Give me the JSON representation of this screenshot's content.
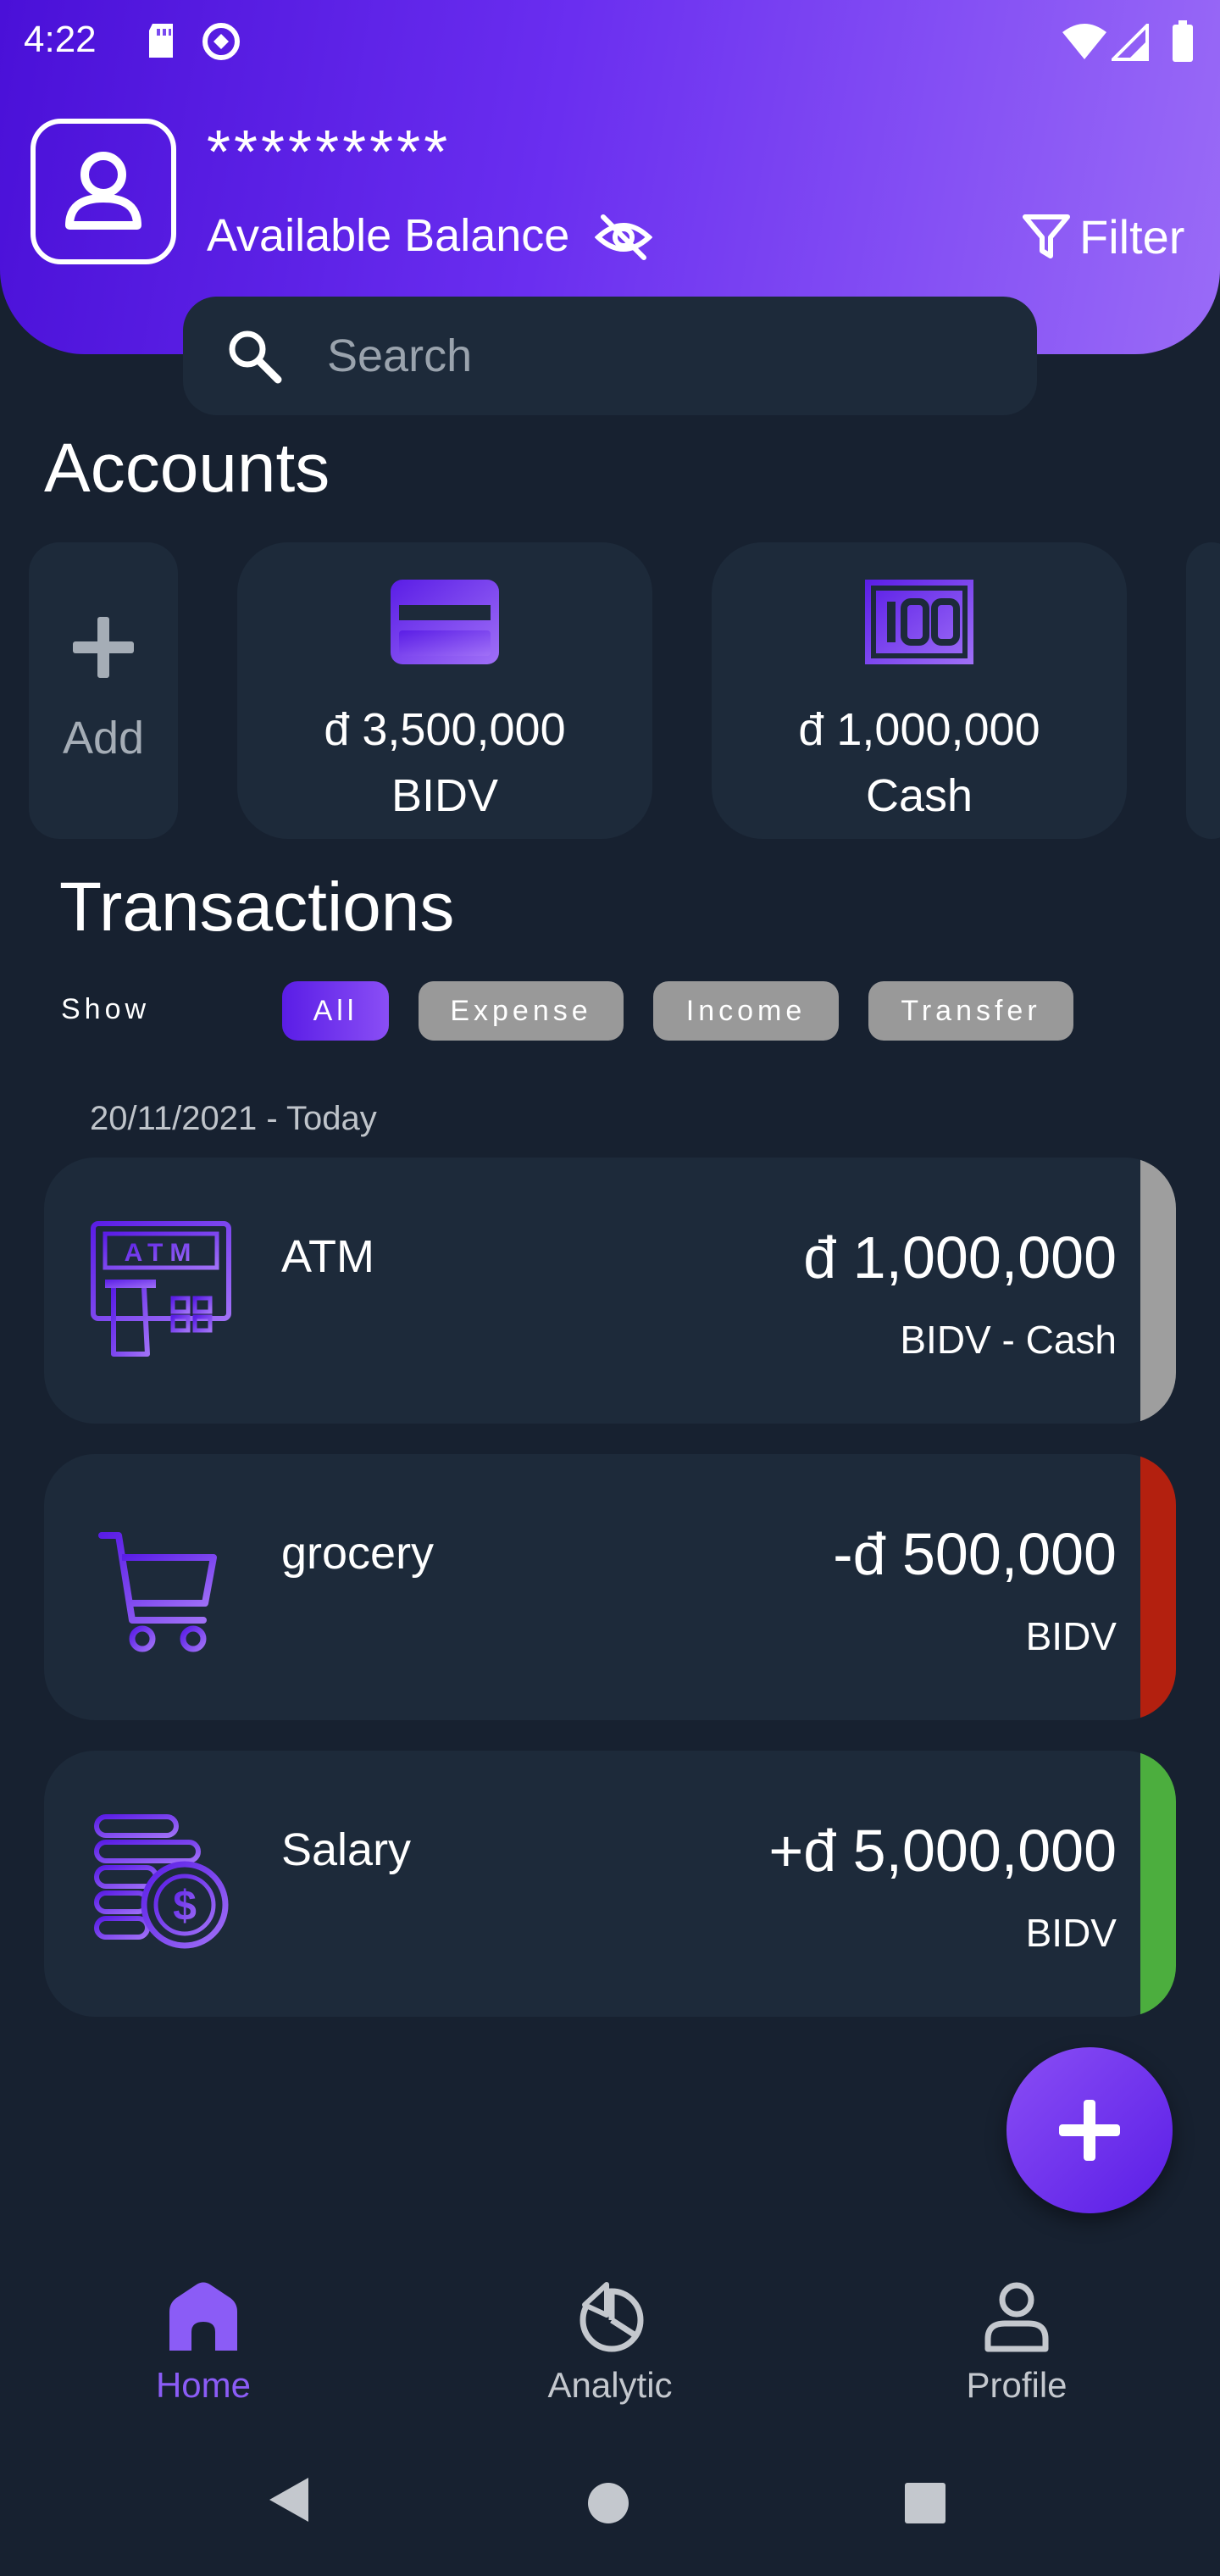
{
  "status_bar": {
    "time": "4:22",
    "icons": [
      "sd-card-icon",
      "sync-icon",
      "wifi-icon",
      "signal-icon",
      "battery-icon"
    ]
  },
  "header": {
    "masked_balance": "*********",
    "balance_label": "Available Balance",
    "filter_label": "Filter",
    "gradient_colors": [
      "#4a10d8",
      "#9a6bf7"
    ]
  },
  "search": {
    "placeholder": "Search",
    "value": ""
  },
  "accounts": {
    "title": "Accounts",
    "add_label": "Add",
    "items": [
      {
        "amount": "đ 3,500,000",
        "name": "BIDV",
        "icon": "credit-card-icon"
      },
      {
        "amount": "đ 1,000,000",
        "name": "Cash",
        "icon": "banknote-icon"
      }
    ]
  },
  "transactions": {
    "title": "Transactions",
    "show_label": "Show",
    "filters": [
      "All",
      "Expense",
      "Income",
      "Transfer"
    ],
    "active_filter": "All",
    "date_header": "20/11/2021 - Today",
    "items": [
      {
        "title": "ATM",
        "amount": "đ 1,000,000",
        "account": "BIDV - Cash",
        "type": "transfer",
        "color": "#9e9e9e",
        "icon": "atm-icon"
      },
      {
        "title": "grocery",
        "amount": "-đ 500,000",
        "account": "BIDV",
        "type": "expense",
        "color": "#b3200f",
        "icon": "shopping-cart-icon"
      },
      {
        "title": "Salary",
        "amount": "+đ 5,000,000",
        "account": "BIDV",
        "type": "income",
        "color": "#4cae3e",
        "icon": "coins-icon"
      }
    ]
  },
  "bottom_nav": {
    "items": [
      {
        "label": "Home",
        "icon": "home-icon",
        "active": true
      },
      {
        "label": "Analytic",
        "icon": "pie-chart-icon",
        "active": false
      },
      {
        "label": "Profile",
        "icon": "user-icon",
        "active": false
      }
    ],
    "active_color": "#8b5cf6",
    "inactive_color": "#c4c8ce"
  },
  "theme": {
    "background": "#172130",
    "card": "#1d2a3a",
    "accent": "#6a2ef0"
  }
}
